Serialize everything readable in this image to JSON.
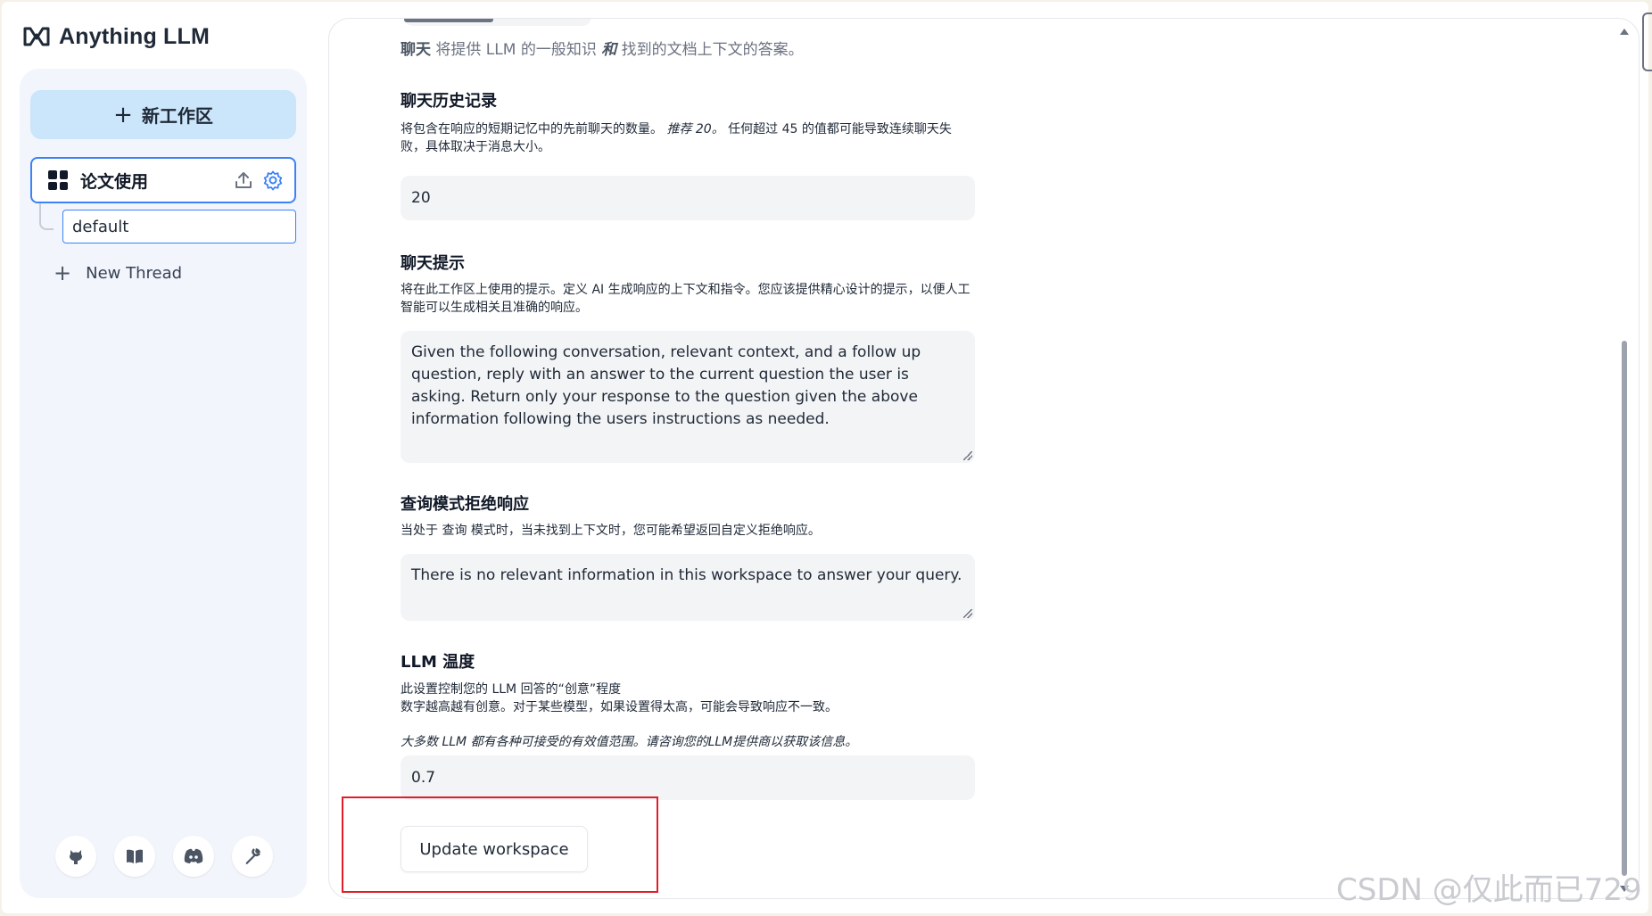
{
  "app": {
    "brand": "Anything LLM",
    "brand_icon": "anythingllm-logo-icon"
  },
  "sidebar": {
    "new_workspace_label": "新工作区",
    "workspace": {
      "name": "论文使用",
      "icons": [
        "upload-icon",
        "gear-icon"
      ]
    },
    "thread": {
      "name": "default"
    },
    "new_thread_label": "New Thread",
    "footer_icons": [
      "github-icon",
      "book-icon",
      "discord-icon",
      "wrench-icon"
    ]
  },
  "settings": {
    "intro": {
      "bold": "聊天",
      "text1": " 将提供 LLM 的一般知识 ",
      "italic": "和",
      "text2": " 找到的文档上下文的答案。"
    },
    "history": {
      "title": "聊天历史记录",
      "desc1": "将包含在响应的短期记忆中的先前聊天的数量。",
      "desc_italic": " 推荐 20。",
      "desc2": " 任何超过 45 的值都可能导致连续聊天失败，具体取决于消息大小。",
      "value": "20"
    },
    "prompt": {
      "title": "聊天提示",
      "desc": "将在此工作区上使用的提示。定义 AI 生成响应的上下文和指令。您应该提供精心设计的提示，以便人工智能可以生成相关且准确的响应。",
      "value": "Given the following conversation, relevant context, and a follow up question, reply with an answer to the current question the user is asking. Return only your response to the question given the above information following the users instructions as needed."
    },
    "refusal": {
      "title": "查询模式拒绝响应",
      "desc": "当处于 查询 模式时，当未找到上下文时，您可能希望返回自定义拒绝响应。",
      "value": "There is no relevant information in this workspace to answer your query."
    },
    "temperature": {
      "title": "LLM 温度",
      "desc1": "此设置控制您的 LLM 回答的“创意”程度",
      "desc2": "数字越高越有创意。对于某些模型，如果设置得太高，可能会导致响应不一致。",
      "note": "大多数 LLM 都有各种可接受的有效值范围。请咨询您的LLM提供商以获取该信息。",
      "value": "0.7"
    },
    "update_button": "Update workspace"
  },
  "watermark": "CSDN @仅此而已729",
  "colors": {
    "accent": "#3b82f6",
    "new_workspace_bg": "#cbe5fb",
    "highlight": "#e11d2a"
  }
}
